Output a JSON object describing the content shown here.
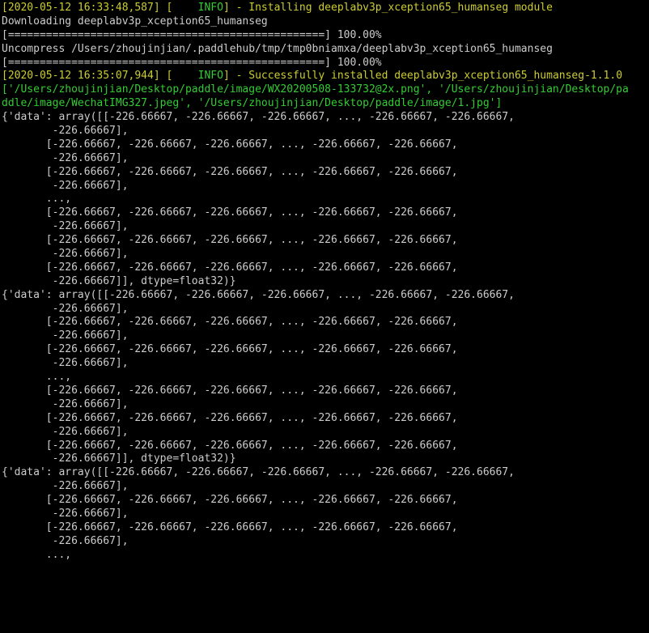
{
  "log": {
    "line1": {
      "ts": "[2020-05-12 16:33:48,587] [",
      "level": "    INFO",
      "tail": "] - Installing deeplabv3p_xception65_humanseg module"
    },
    "line2": "Downloading deeplabv3p_xception65_humanseg",
    "line3": "[==================================================] 100.00%",
    "line4": "Uncompress /Users/zhoujinjian/.paddlehub/tmp/tmp0bniamxa/deeplabv3p_xception65_humanseg",
    "line5": "[==================================================] 100.00%",
    "line6": {
      "ts": "[2020-05-12 16:35:07,944] [",
      "level": "    INFO",
      "tail": "] - Successfully installed deeplabv3p_xception65_humanseg-1.1.0"
    },
    "line7": "['/Users/zhoujinjian/Desktop/paddle/image/WX20200508-133732@2x.png', '/Users/zhoujinjian/Desktop/pa",
    "line8": "ddle/image/WechatIMG327.jpeg', '/Users/zhoujinjian/Desktop/paddle/image/1.jpg']",
    "arr1": {
      "r1": "{'data': array([[-226.66667, -226.66667, -226.66667, ..., -226.66667, -226.66667,",
      "r1b": "        -226.66667],",
      "r2": "       [-226.66667, -226.66667, -226.66667, ..., -226.66667, -226.66667,",
      "r2b": "        -226.66667],",
      "r3": "       [-226.66667, -226.66667, -226.66667, ..., -226.66667, -226.66667,",
      "r3b": "        -226.66667],",
      "dots": "       ...,",
      "r4": "       [-226.66667, -226.66667, -226.66667, ..., -226.66667, -226.66667,",
      "r4b": "        -226.66667],",
      "r5": "       [-226.66667, -226.66667, -226.66667, ..., -226.66667, -226.66667,",
      "r5b": "        -226.66667],",
      "r6": "       [-226.66667, -226.66667, -226.66667, ..., -226.66667, -226.66667,",
      "r6b": "        -226.66667]], dtype=float32)}"
    },
    "arr2": {
      "r1": "{'data': array([[-226.66667, -226.66667, -226.66667, ..., -226.66667, -226.66667,",
      "r1b": "        -226.66667],",
      "r2": "       [-226.66667, -226.66667, -226.66667, ..., -226.66667, -226.66667,",
      "r2b": "        -226.66667],",
      "r3": "       [-226.66667, -226.66667, -226.66667, ..., -226.66667, -226.66667,",
      "r3b": "        -226.66667],",
      "dots": "       ...,",
      "r4": "       [-226.66667, -226.66667, -226.66667, ..., -226.66667, -226.66667,",
      "r4b": "        -226.66667],",
      "r5": "       [-226.66667, -226.66667, -226.66667, ..., -226.66667, -226.66667,",
      "r5b": "        -226.66667],",
      "r6": "       [-226.66667, -226.66667, -226.66667, ..., -226.66667, -226.66667,",
      "r6b": "        -226.66667]], dtype=float32)}"
    },
    "arr3": {
      "r1": "{'data': array([[-226.66667, -226.66667, -226.66667, ..., -226.66667, -226.66667,",
      "r1b": "        -226.66667],",
      "r2": "       [-226.66667, -226.66667, -226.66667, ..., -226.66667, -226.66667,",
      "r2b": "        -226.66667],",
      "r3": "       [-226.66667, -226.66667, -226.66667, ..., -226.66667, -226.66667,",
      "r3b": "        -226.66667],",
      "dots": "       ...,"
    }
  }
}
